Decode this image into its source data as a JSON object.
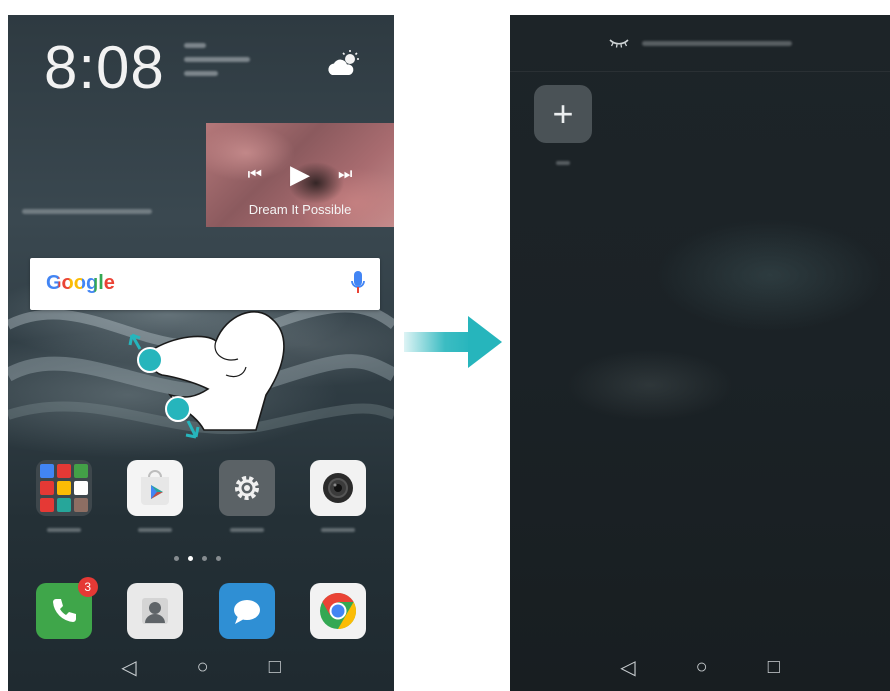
{
  "left_screen": {
    "clock": "8:08",
    "weather_icon": "cloud-sun-icon",
    "music_widget": {
      "song_title": "Dream It Possible"
    },
    "google_bar": {
      "logo": "Google",
      "mic_icon": "mic-icon"
    },
    "apps_row": [
      {
        "name": "folder",
        "icon": "folder-icon"
      },
      {
        "name": "play-store",
        "icon": "play-store-icon"
      },
      {
        "name": "settings",
        "icon": "gear-icon"
      },
      {
        "name": "camera",
        "icon": "camera-icon"
      }
    ],
    "dock": [
      {
        "name": "phone",
        "icon": "phone-icon",
        "badge": "3"
      },
      {
        "name": "contacts",
        "icon": "contacts-icon"
      },
      {
        "name": "messages",
        "icon": "message-icon"
      },
      {
        "name": "chrome",
        "icon": "chrome-icon"
      }
    ],
    "page_dots": 4,
    "active_page": 2
  },
  "right_screen": {
    "header_icon": "eye-closed-icon",
    "add_button": "+"
  },
  "navbar": {
    "back": "◁",
    "home": "○",
    "recents": "□"
  },
  "colors": {
    "accent": "#26b5bc",
    "badge": "#e53935",
    "phone_green": "#3fa64a",
    "message_blue": "#2f8fd4"
  }
}
